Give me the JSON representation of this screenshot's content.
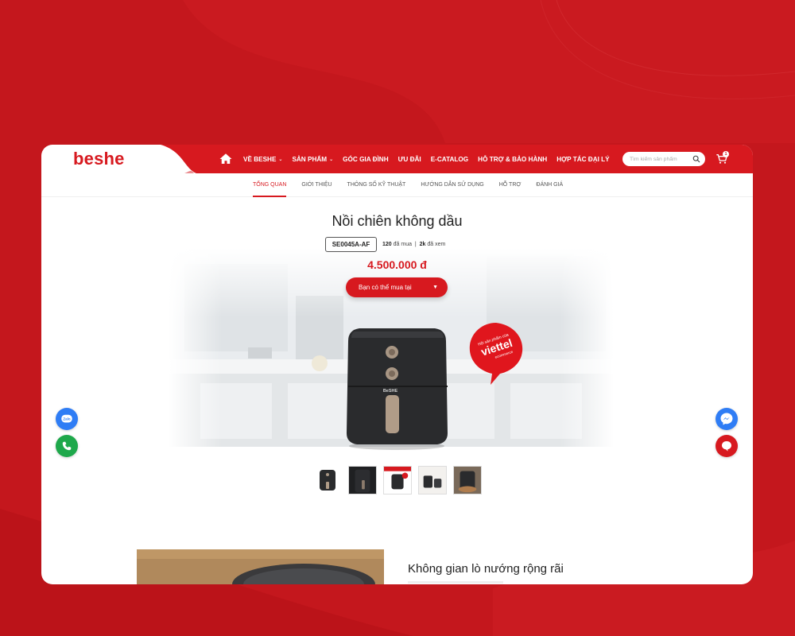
{
  "brand": {
    "logo_text": "beshe"
  },
  "nav": {
    "items": [
      {
        "label": "VỀ BESHE",
        "has_dropdown": true
      },
      {
        "label": "SẢN PHẨM",
        "has_dropdown": true
      },
      {
        "label": "GÓC GIA ĐÌNH",
        "has_dropdown": false
      },
      {
        "label": "ƯU ĐÃI",
        "has_dropdown": false
      },
      {
        "label": "E-CATALOG",
        "has_dropdown": false
      },
      {
        "label": "HỖ TRỢ & BẢO HÀNH",
        "has_dropdown": false
      },
      {
        "label": "HỢP TÁC ĐẠI LÝ",
        "has_dropdown": false
      }
    ]
  },
  "search": {
    "placeholder": "Tìm kiếm sản phẩm"
  },
  "cart": {
    "count": "1"
  },
  "tabs": [
    {
      "label": "TỔNG QUAN",
      "active": true
    },
    {
      "label": "GIỚI THIỆU",
      "active": false
    },
    {
      "label": "THÔNG SỐ KỸ THUẬT",
      "active": false
    },
    {
      "label": "HƯỚNG DẪN SỬ DỤNG",
      "active": false
    },
    {
      "label": "HỖ TRỢ",
      "active": false
    },
    {
      "label": "ĐÁNH GIÁ",
      "active": false
    }
  ],
  "product": {
    "title": "Nồi chiên không dầu",
    "sku": "SE0045A-AF",
    "sold_count": "120",
    "sold_label": "đã mua",
    "views_count": "2k",
    "views_label": "đã xem",
    "separator": "|",
    "price": "4.500.000 đ",
    "buy_label": "Bạn có thể mua tại",
    "device_brand": "BeSHE",
    "badge_text_1": "Hội sản phẩm của",
    "badge_text_2": "viettel",
    "badge_text_3": "ecommerce"
  },
  "thumbnails": [
    "fryer-front",
    "fryer-side",
    "fryer-promo",
    "fryer-kitchen",
    "fryer-food"
  ],
  "feature": {
    "title": "Không gian lò nướng rộng rãi"
  },
  "floating": {
    "left": [
      {
        "name": "zalo",
        "label": "Zalo"
      },
      {
        "name": "phone"
      }
    ],
    "right": [
      {
        "name": "messenger"
      },
      {
        "name": "chat"
      }
    ]
  },
  "colors": {
    "brand_red": "#d7191f",
    "background_red": "#c4171d"
  }
}
